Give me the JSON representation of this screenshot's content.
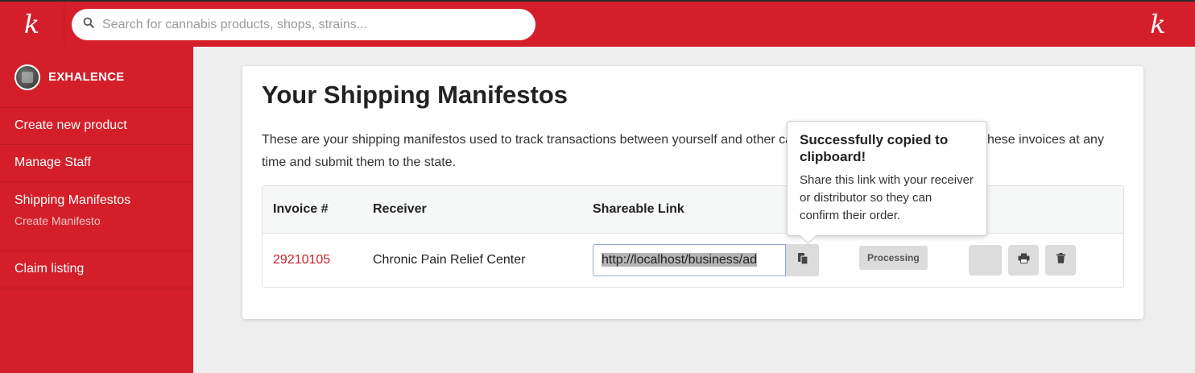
{
  "header": {
    "logo_left": "k",
    "logo_right": "k",
    "search": {
      "placeholder": "Search for cannabis products, shops, strains..."
    }
  },
  "sidebar": {
    "profile_name": "EXHALENCE",
    "items": [
      {
        "label": "Create new product"
      },
      {
        "label": "Manage Staff"
      },
      {
        "label": "Shipping Manifestos",
        "sub": "Create Manifesto"
      },
      {
        "label": "Claim listing"
      }
    ]
  },
  "main": {
    "title": "Your Shipping Manifestos",
    "description": "These are your shipping manifestos used to track transactions between yourself and other cannabis businesses. You can print these invoices at any time and submit them to the state.",
    "table": {
      "headers": {
        "invoice": "Invoice #",
        "receiver": "Receiver",
        "link": "Shareable Link"
      },
      "rows": [
        {
          "invoice": "29210105",
          "receiver": "Chronic Pain Relief Center",
          "link": "http://localhost/business/ad",
          "status": "Processing"
        }
      ]
    }
  },
  "tooltip": {
    "title": "Successfully copied to clipboard!",
    "body": "Share this link with your receiver or distributor so they can confirm their order."
  },
  "colors": {
    "brand": "#d41f2a",
    "link": "#c9222b"
  },
  "icons": [
    "search-icon",
    "copy-icon",
    "print-icon",
    "trash-icon"
  ]
}
